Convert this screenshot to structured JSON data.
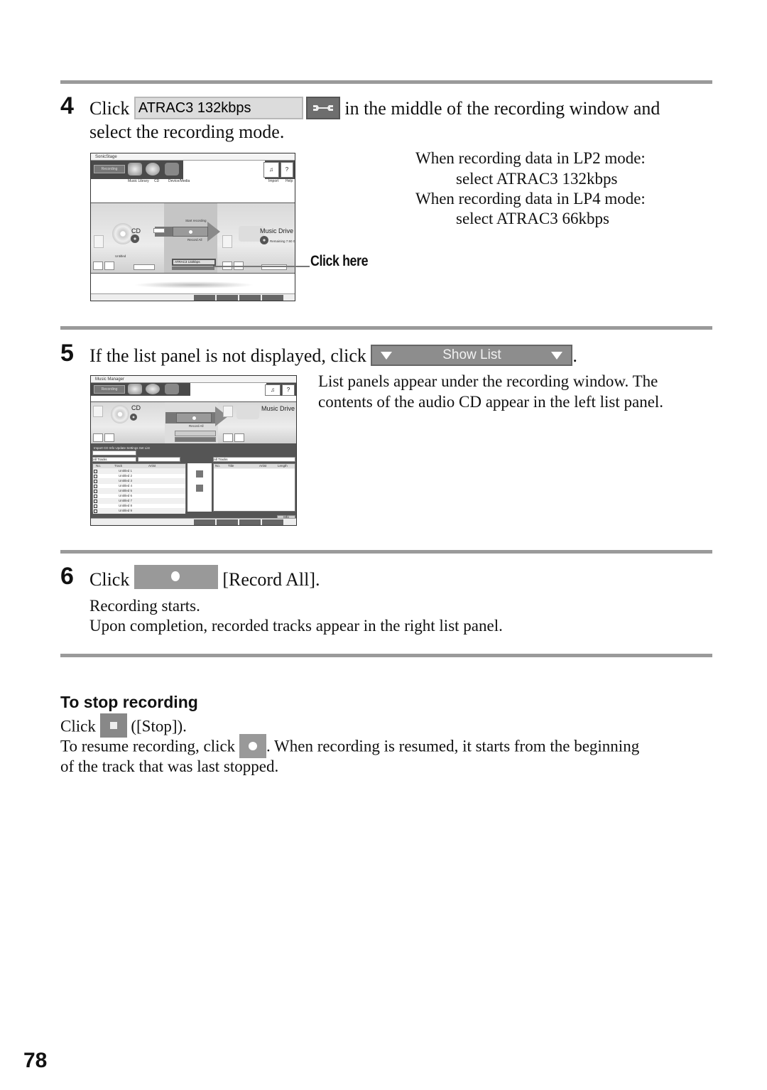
{
  "page_number": "78",
  "steps": [
    {
      "number": "4",
      "click_word": "Click",
      "mode_field_value": "ATRAC3 132kbps",
      "tool_button_icon": "wrench-icon",
      "instruction_rest": "in the middle of the recording window and",
      "instruction_line2": "select the recording mode.",
      "notes": [
        "When recording data in LP2 mode:",
        "select ATRAC3 132kbps",
        "When recording data in LP4 mode:",
        "select ATRAC3 66kbps"
      ],
      "callout": "Click here",
      "screenshot": {
        "window_title": "SonicStage",
        "nav_button": "Recording",
        "toolbar_labels": [
          "Music Library",
          "CD",
          "Device/Media"
        ],
        "right_labels": [
          "Import",
          "Help"
        ],
        "source_label": "CD",
        "center_label": "Start recording",
        "record_label": "Record All",
        "dest_label": "Music Drive",
        "dest_info": "Remaining 7.50 GB",
        "source_track": "Untitled",
        "mode_value": "ATRAC3 132kbps"
      }
    },
    {
      "number": "5",
      "instruction": "If the list panel is not displayed, click",
      "show_list_label": "Show List",
      "trailing": ".",
      "notes": [
        "List panels appear under the recording window. The",
        "contents of the audio CD appear in the left list panel."
      ],
      "screenshot": {
        "window_title": "Music Manager",
        "nav_button": "Recording",
        "source_label": "CD",
        "dest_label": "Music Drive",
        "record_label": "Record All",
        "list_tabs": "Import CD Info   Update   Settings   Set List",
        "left_dropdown": "All Tracks",
        "right_dropdown": "All Tracks",
        "left_columns": [
          "No.",
          "Track",
          "Artist"
        ],
        "right_columns": [
          "No.",
          "Title",
          "Artist",
          "Length"
        ],
        "middle_buttons": [
          "Record",
          "Stop"
        ],
        "track_rows": [
          "Untitled 1",
          "Untitled 2",
          "Untitled 3",
          "Untitled 4",
          "Untitled 5",
          "Untitled 6",
          "Untitled 7",
          "Untitled 8",
          "Untitled 9"
        ],
        "bottom_button": "Info"
      }
    },
    {
      "number": "6",
      "click_word": "Click",
      "button_icon": "record-icon",
      "label": "[Record All].",
      "notes": [
        "Recording starts.",
        "Upon completion, recorded tracks appear in the right list panel."
      ]
    }
  ],
  "stop_section": {
    "heading": "To stop recording",
    "line1_prefix": "Click",
    "line1_suffix": "([Stop]).",
    "line2_prefix": "To resume recording, click",
    "line2_suffix": ". When recording is resumed, it starts from the beginning",
    "line3": "of the track that was last stopped."
  }
}
